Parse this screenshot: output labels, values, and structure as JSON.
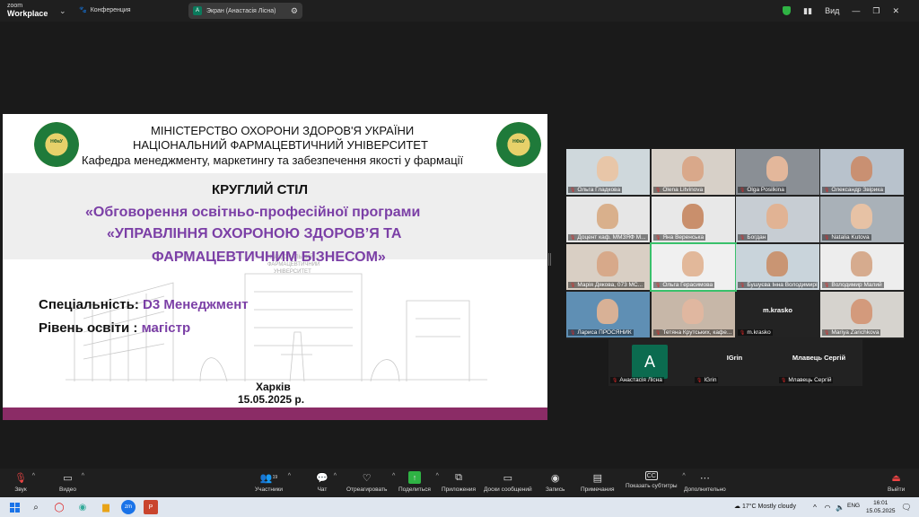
{
  "app": {
    "brand_line1": "zoom",
    "brand_line2": "Workplace",
    "conference_label": "Конференция",
    "screen_share_label": "Экран (Анастасія Лісна)",
    "view_label": "Вид"
  },
  "slide": {
    "line1": "МІНІСТЕРСТВО ОХОРОНИ ЗДОРОВ'Я УКРАЇНИ",
    "line2": "НАЦІОНАЛЬНИЙ ФАРМАЦЕВТИЧНИЙ УНІВЕРСИТЕТ",
    "line3": "Кафедра менеджменту, маркетингу та забезпечення якості у фармації",
    "title": "КРУГЛИЙ СТІЛ",
    "prog1": "«Обговорення освітньо-професійної програми",
    "prog2": "«УПРАВЛІННЯ ОХОРОНОЮ ЗДОРОВ’Я ТА",
    "prog3": "ФАРМАЦЕВТИЧНИМ БІЗНЕСОМ»",
    "spec_label": "Спеціальність:",
    "spec_value": "D3 Менеджмент",
    "level_label": "Рівень освіти :",
    "level_value": "магістр",
    "city": "Харків",
    "date": "15.05.2025 р.",
    "seal_text": "НФаУ",
    "building_text1": "НАЦІОНАЛЬНИЙ",
    "building_text2": "ФАРМАЦЕВТИЧНИЙ",
    "building_text3": "УНІВЕРСИТЕТ"
  },
  "participants": [
    {
      "name": "Ольга Гладкова"
    },
    {
      "name": "Olena Litvinova"
    },
    {
      "name": "Olga Posilkina"
    },
    {
      "name": "Олександр Звірика"
    },
    {
      "name": "Доцент каф. ММЗЯФ М..."
    },
    {
      "name": "Яна Веренська"
    },
    {
      "name": "Богдан"
    },
    {
      "name": "Natalia Kutova"
    },
    {
      "name": "Марія Дякова, 073 МС..."
    },
    {
      "name": "Ольга Герасимова"
    },
    {
      "name": "Бушуєва Інна Володимирів..."
    },
    {
      "name": "Володимир Малий"
    },
    {
      "name": "Лариса ПРОСЯНИК"
    },
    {
      "name": "Тетяна Крутських, кафе..."
    },
    {
      "name": "m.krasko",
      "center": "m.krasko"
    },
    {
      "name": "Mariya Zarichkova"
    },
    {
      "name": "Анастасія Лісна",
      "initial": "A"
    },
    {
      "name": "IGrin",
      "center": "IGrin"
    },
    {
      "name": "Млавець Сергій",
      "center": "Млавець Сергій"
    }
  ],
  "toolbar": {
    "audio": "Звук",
    "video": "Видео",
    "participants": "Участники",
    "participants_count": "19",
    "chat": "Чат",
    "react": "Отреагировать",
    "share": "Поделиться",
    "apps": "Приложения",
    "whiteboards": "Доски сообщений",
    "record": "Запись",
    "notes": "Примечания",
    "captions": "Показать субтитры",
    "more": "Дополнительно",
    "leave": "Выйти"
  },
  "taskbar": {
    "weather": "17°C  Mostly cloudy",
    "lang": "ENG",
    "time": "16:01",
    "date": "15.05.2025"
  },
  "colors": {
    "accent_purple": "#7b3fa6",
    "bottom_band": "#8b2c66",
    "green": "#39c06b"
  }
}
